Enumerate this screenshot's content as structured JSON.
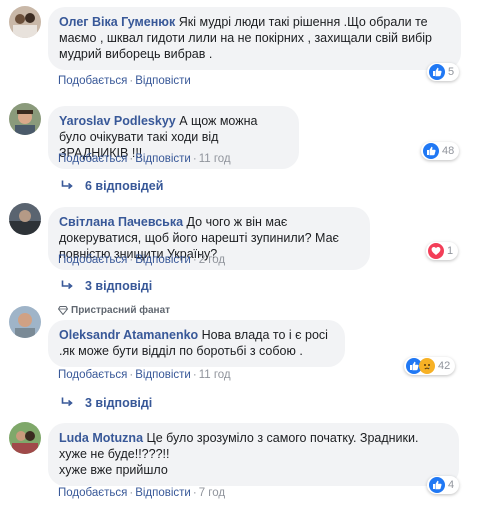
{
  "colors": {
    "link": "#385898",
    "meta": "#90949c",
    "bubble": "#f2f3f5",
    "like": "#2078f4",
    "love": "#f33e58"
  },
  "comments": [
    {
      "author": "Олег Віка Гуменюк",
      "text": "Які мудрі люди такі рішення .Що обрали те маємо , шквал гидоти лили на не покірних , захищали свій вибір мудрий виборець вибрав .",
      "like": "Подобається",
      "reply": "Відповісти",
      "time": "",
      "reaction_count": "5",
      "reaction_icons": [
        "like-icon"
      ]
    },
    {
      "author": "Yaroslav Podleskyy",
      "text": "А щож можна було очікувати такі ходи від ЗРАДНИКІВ !!!",
      "like": "Подобається",
      "reply": "Відповісти",
      "time": "11 год",
      "reaction_count": "48",
      "reaction_icons": [
        "like-icon"
      ],
      "replies_label": "6 відповідей"
    },
    {
      "author": "Світлана Пачевська",
      "text": "До чого ж він має докеруватися, щоб його нарешті зупинили? Має повністю знищити Україну?",
      "like": "Подобається",
      "reply": "Відповісти",
      "time": "2 год",
      "reaction_count": "1",
      "reaction_icons": [
        "love-icon"
      ],
      "replies_label": "3 відповіді"
    },
    {
      "badge": "Пристрасний фанат",
      "author": "Oleksandr Atamanenko",
      "text": "Нова влада то і є росі .як може бути відділ по боротьбі з собою .",
      "like": "Подобається",
      "reply": "Відповісти",
      "time": "11 год",
      "reaction_count": "42",
      "reaction_icons": [
        "like-icon",
        "sad-icon"
      ],
      "replies_label": "3 відповіді"
    },
    {
      "author": "Luda Motuzna",
      "text": "Це було зрозуміло з самого початку. Зрадники. хуже не буде!!???!!",
      "text2": "хуже вже прийшло",
      "like": "Подобається",
      "reply": "Відповісти",
      "time": "7 год",
      "reaction_count": "4",
      "reaction_icons": [
        "like-icon"
      ]
    }
  ]
}
